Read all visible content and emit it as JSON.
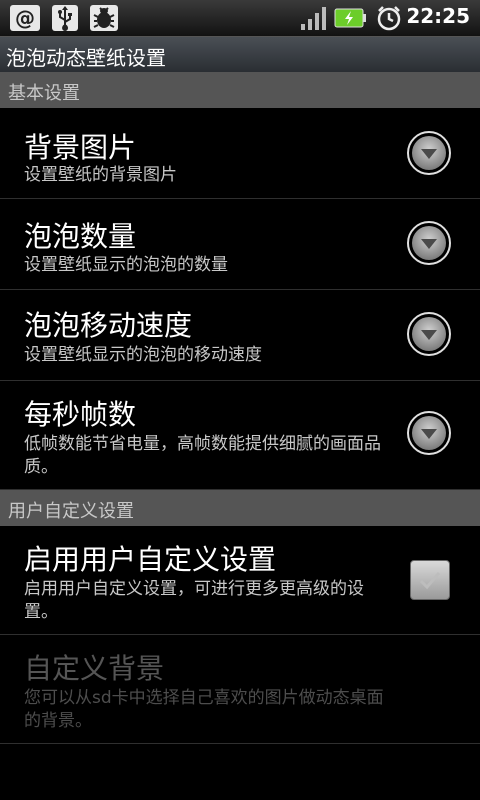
{
  "status_bar": {
    "time": "22:25",
    "icons": [
      "at-sign-icon",
      "usb-icon",
      "debug-bug-icon",
      "signal-icon",
      "battery-charging-icon",
      "alarm-clock-icon"
    ]
  },
  "app": {
    "title": "泡泡动态壁纸设置"
  },
  "sections": [
    {
      "header": "基本设置",
      "items": [
        {
          "title": "背景图片",
          "summary": "设置壁纸的背景图片",
          "widget": "dropdown-icon"
        },
        {
          "title": "泡泡数量",
          "summary": "设置壁纸显示的泡泡的数量",
          "widget": "dropdown-icon"
        },
        {
          "title": "泡泡移动速度",
          "summary": "设置壁纸显示的泡泡的移动速度",
          "widget": "dropdown-icon"
        },
        {
          "title": "每秒帧数",
          "summary": "低帧数能节省电量，高帧数能提供细腻的画面品质。",
          "widget": "dropdown-icon"
        }
      ]
    },
    {
      "header": "用户自定义设置",
      "items": [
        {
          "title": "启用用户自定义设置",
          "summary": "启用用户自定义设置，可进行更多更高级的设置。",
          "widget": "checkbox",
          "checked": false
        },
        {
          "title": "自定义背景",
          "summary": "您可以从sd卡中选择自己喜欢的图片做动态桌面的背景。",
          "enabled": false
        }
      ]
    }
  ],
  "colors": {
    "background": "#000000",
    "section_header_bg": "#555555",
    "primary_text": "#ffffff",
    "secondary_text": "#c8c8c8",
    "disabled_text": "#555555"
  }
}
